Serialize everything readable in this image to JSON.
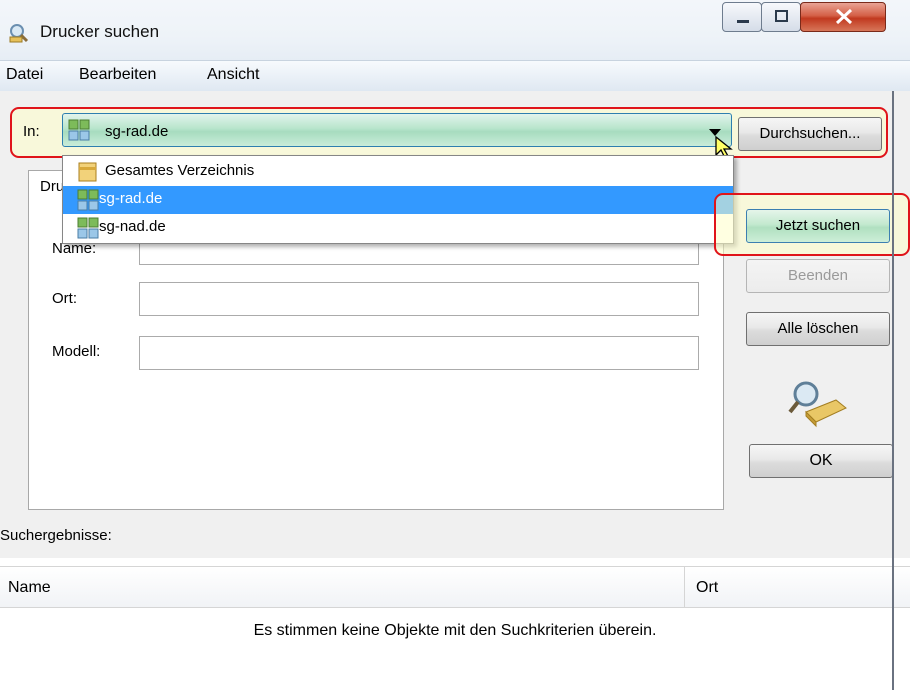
{
  "window": {
    "title": "Drucker suchen",
    "icon": "printer-search-icon"
  },
  "menu": [
    "Datei",
    "Bearbeiten",
    "Ansicht"
  ],
  "scope": {
    "label": "In:",
    "value": "sg-rad.de",
    "browse_label": "Durchsuchen...",
    "options": [
      {
        "label": "Gesamtes Verzeichnis",
        "icon": "directory-icon",
        "selected": false
      },
      {
        "label": "sg-rad.de",
        "icon": "domain-icon",
        "selected": true
      },
      {
        "label": "sg-nad.de",
        "icon": "domain-icon",
        "selected": false
      }
    ]
  },
  "criteria": {
    "tab_label": "Dru",
    "fields": [
      {
        "label": "Name:",
        "value": ""
      },
      {
        "label": "Ort:",
        "value": ""
      },
      {
        "label": "Modell:",
        "value": ""
      }
    ]
  },
  "buttons": {
    "search": "Jetzt suchen",
    "stop": "Beenden",
    "clear": "Alle löschen",
    "ok": "OK"
  },
  "results": {
    "label": "Suchergebnisse:",
    "columns": [
      "Name",
      "Ort"
    ],
    "empty_message": "Es stimmen keine Objekte mit den Suchkriterien überein."
  },
  "colors": {
    "highlight_border": "#e0141a",
    "selection": "#3399ff",
    "combo_green": "#b8e5cc"
  }
}
